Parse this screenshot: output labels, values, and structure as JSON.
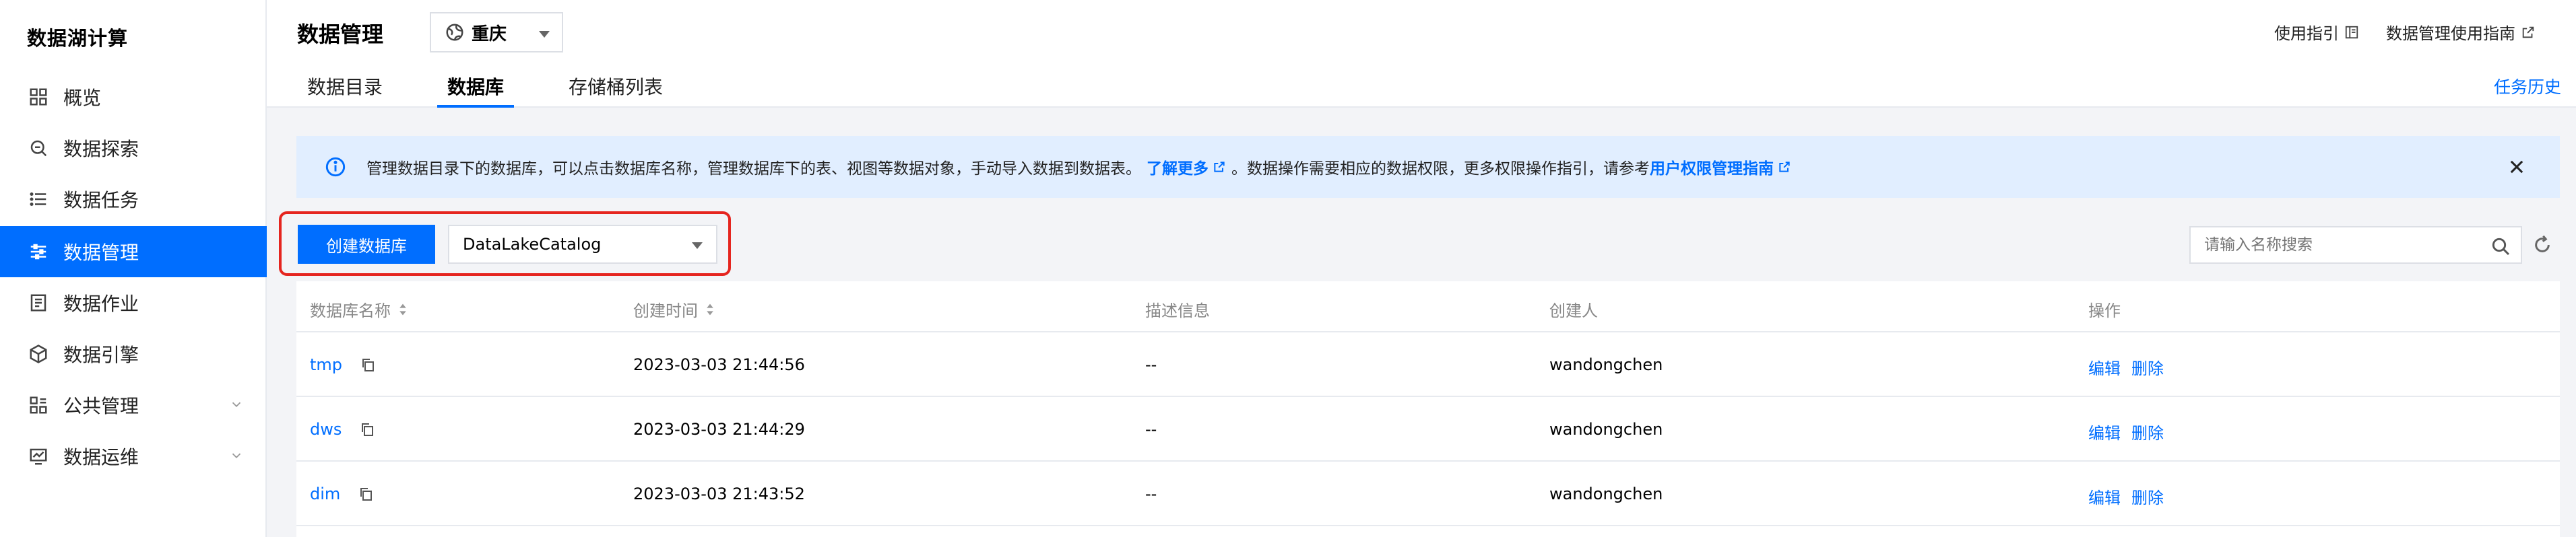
{
  "sidebar": {
    "brand": "数据湖计算",
    "items": [
      {
        "label": "概览",
        "icon": "grid-icon"
      },
      {
        "label": "数据探索",
        "icon": "search-doc-icon"
      },
      {
        "label": "数据任务",
        "icon": "list-icon"
      },
      {
        "label": "数据管理",
        "icon": "settings-list-icon",
        "active": true
      },
      {
        "label": "数据作业",
        "icon": "doc-icon"
      },
      {
        "label": "数据引擎",
        "icon": "cube-icon"
      },
      {
        "label": "公共管理",
        "icon": "apps-icon",
        "expandable": true
      },
      {
        "label": "数据运维",
        "icon": "monitor-icon",
        "expandable": true
      }
    ]
  },
  "header": {
    "title": "数据管理",
    "region": "重庆",
    "tabs": [
      {
        "label": "数据目录"
      },
      {
        "label": "数据库",
        "active": true
      },
      {
        "label": "存储桶列表"
      }
    ],
    "links": [
      "使用指引",
      "数据管理使用指南"
    ],
    "task_history": "任务历史"
  },
  "banner": {
    "text1": "管理数据目录下的数据库，可以点击数据库名称，管理数据库下的表、视图等数据对象，手动导入数据到数据表。",
    "link1": "了解更多",
    "text2": "。数据操作需要相应的数据权限，更多权限操作指引，请参考",
    "link2": "用户权限管理指南"
  },
  "toolbar": {
    "create_label": "创建数据库",
    "catalog_value": "DataLakeCatalog",
    "search_placeholder": "请输入名称搜索"
  },
  "table": {
    "columns": [
      "数据库名称",
      "创建时间",
      "描述信息",
      "创建人",
      "操作"
    ],
    "rows": [
      {
        "name": "tmp",
        "created": "2023-03-03 21:44:56",
        "desc": "--",
        "creator": "wandongchen"
      },
      {
        "name": "dws",
        "created": "2023-03-03 21:44:29",
        "desc": "--",
        "creator": "wandongchen"
      },
      {
        "name": "dim",
        "created": "2023-03-03 21:43:52",
        "desc": "--",
        "creator": "wandongchen"
      }
    ],
    "edit_label": "编辑",
    "delete_label": "删除"
  },
  "colors": {
    "primary": "#006eff",
    "banner_bg": "#e1eeff",
    "highlight": "#e5251f"
  }
}
